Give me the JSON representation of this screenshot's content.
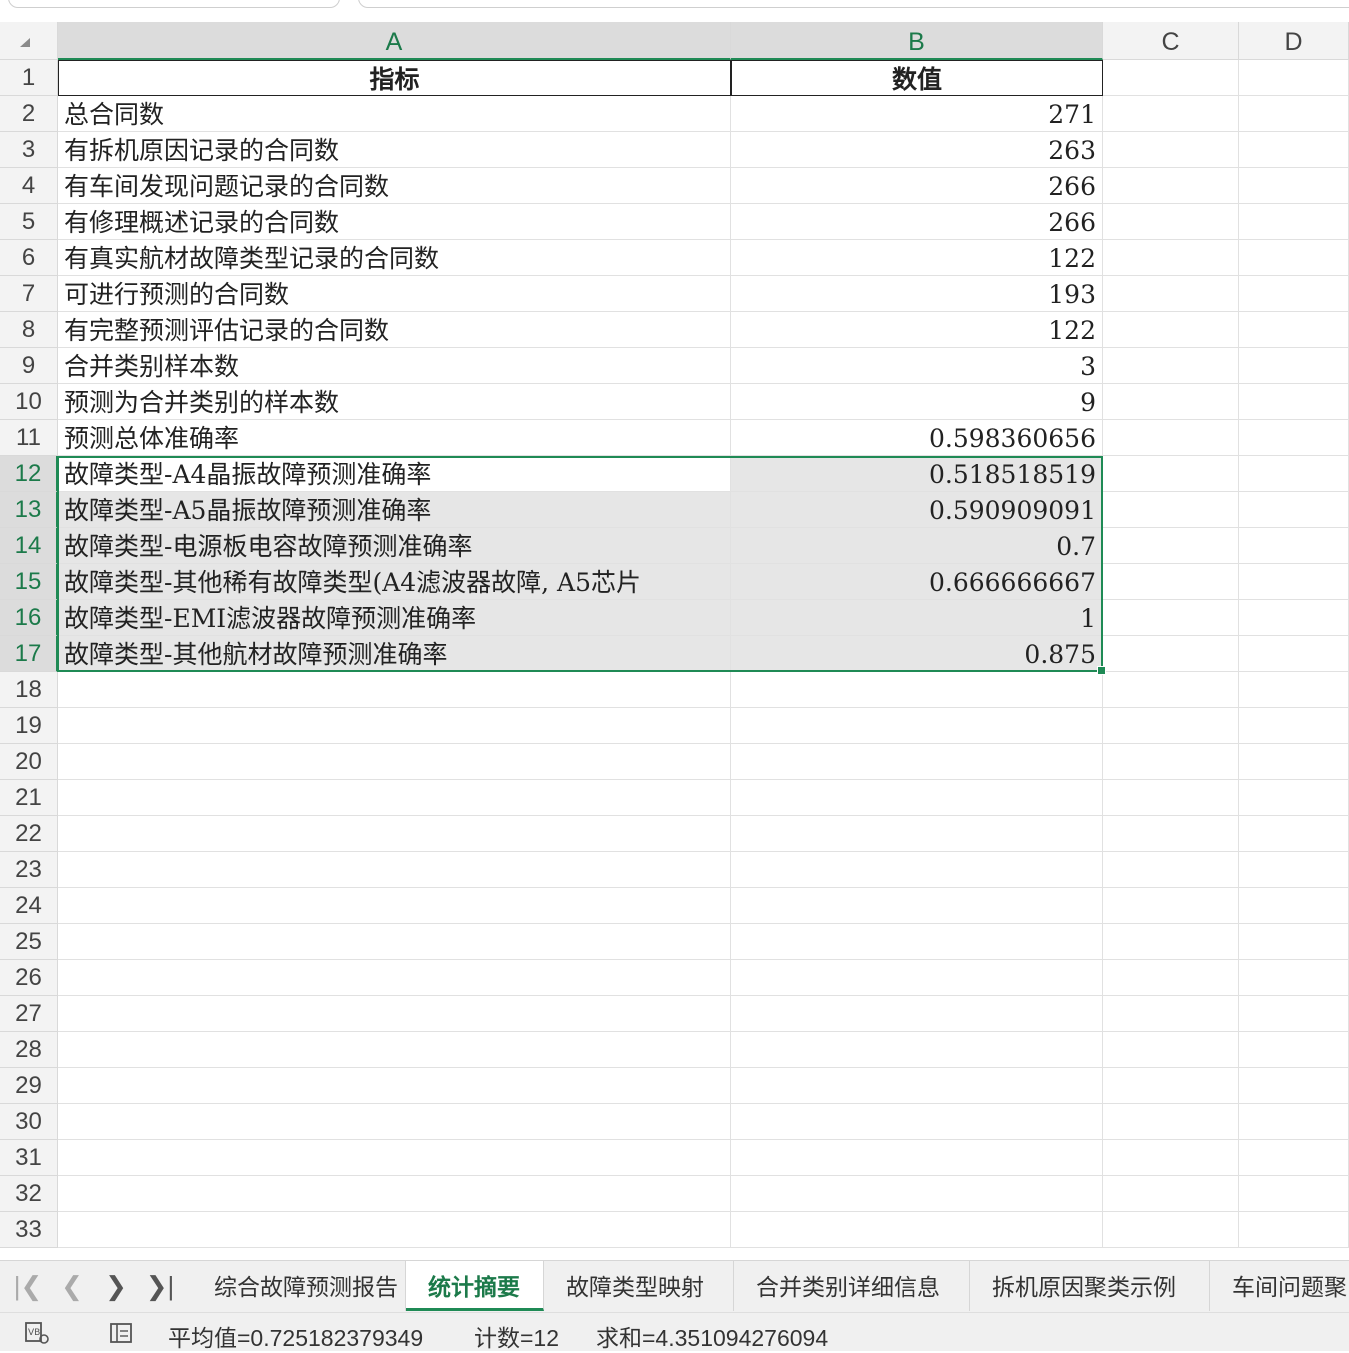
{
  "columns": [
    "A",
    "B",
    "C",
    "D"
  ],
  "corner_icon": "select-all-triangle-icon",
  "rows": [
    {
      "n": "1",
      "a": "指标",
      "b": "数值"
    },
    {
      "n": "2",
      "a": "总合同数",
      "b": "271"
    },
    {
      "n": "3",
      "a": "有拆机原因记录的合同数",
      "b": "263"
    },
    {
      "n": "4",
      "a": "有车间发现问题记录的合同数",
      "b": "266"
    },
    {
      "n": "5",
      "a": "有修理概述记录的合同数",
      "b": "266"
    },
    {
      "n": "6",
      "a": "有真实航材故障类型记录的合同数",
      "b": "122"
    },
    {
      "n": "7",
      "a": "可进行预测的合同数",
      "b": "193"
    },
    {
      "n": "8",
      "a": "有完整预测评估记录的合同数",
      "b": "122"
    },
    {
      "n": "9",
      "a": "合并类别样本数",
      "b": "3"
    },
    {
      "n": "10",
      "a": "预测为合并类别的样本数",
      "b": "9"
    },
    {
      "n": "11",
      "a": "预测总体准确率",
      "b": "0.598360656"
    },
    {
      "n": "12",
      "a": "故障类型-A4晶振故障预测准确率",
      "b": "0.518518519"
    },
    {
      "n": "13",
      "a": "故障类型-A5晶振故障预测准确率",
      "b": "0.590909091"
    },
    {
      "n": "14",
      "a": "故障类型-电源板电容故障预测准确率",
      "b": "0.7"
    },
    {
      "n": "15",
      "a": "故障类型-其他稀有故障类型(A4滤波器故障, A5芯片",
      "b": "0.666666667"
    },
    {
      "n": "16",
      "a": "故障类型-EMI滤波器故障预测准确率",
      "b": "1"
    },
    {
      "n": "17",
      "a": "故障类型-其他航材故障预测准确率",
      "b": "0.875"
    },
    {
      "n": "18",
      "a": "",
      "b": ""
    },
    {
      "n": "19",
      "a": "",
      "b": ""
    },
    {
      "n": "20",
      "a": "",
      "b": ""
    },
    {
      "n": "21",
      "a": "",
      "b": ""
    },
    {
      "n": "22",
      "a": "",
      "b": ""
    },
    {
      "n": "23",
      "a": "",
      "b": ""
    },
    {
      "n": "24",
      "a": "",
      "b": ""
    },
    {
      "n": "25",
      "a": "",
      "b": ""
    },
    {
      "n": "26",
      "a": "",
      "b": ""
    },
    {
      "n": "27",
      "a": "",
      "b": ""
    },
    {
      "n": "28",
      "a": "",
      "b": ""
    },
    {
      "n": "29",
      "a": "",
      "b": ""
    },
    {
      "n": "30",
      "a": "",
      "b": ""
    },
    {
      "n": "31",
      "a": "",
      "b": ""
    },
    {
      "n": "32",
      "a": "",
      "b": ""
    },
    {
      "n": "33",
      "a": "",
      "b": ""
    }
  ],
  "selected_rows": [
    "12",
    "13",
    "14",
    "15",
    "16",
    "17"
  ],
  "sheet_nav": {
    "first_icon": "first-sheet-icon",
    "prev_icon": "prev-sheet-icon",
    "next_icon": "next-sheet-icon",
    "last_icon": "last-sheet-icon"
  },
  "sheet_tabs": [
    {
      "label": "综合故障预测报告",
      "active": false
    },
    {
      "label": "统计摘要",
      "active": true
    },
    {
      "label": "故障类型映射",
      "active": false
    },
    {
      "label": "合并类别详细信息",
      "active": false
    },
    {
      "label": "拆机原因聚类示例",
      "active": false
    },
    {
      "label": "车间问题聚",
      "active": false
    }
  ],
  "status": {
    "macro_icon": "macro-record-icon",
    "view_icon": "sheet-view-icon",
    "average": "平均值=0.725182379349",
    "count": "计数=12",
    "sum": "求和=4.351094276094"
  },
  "colors": {
    "accent": "#1f8a55",
    "selection_fill": "#e6e6e6",
    "header_bg": "#f3f3f3"
  }
}
